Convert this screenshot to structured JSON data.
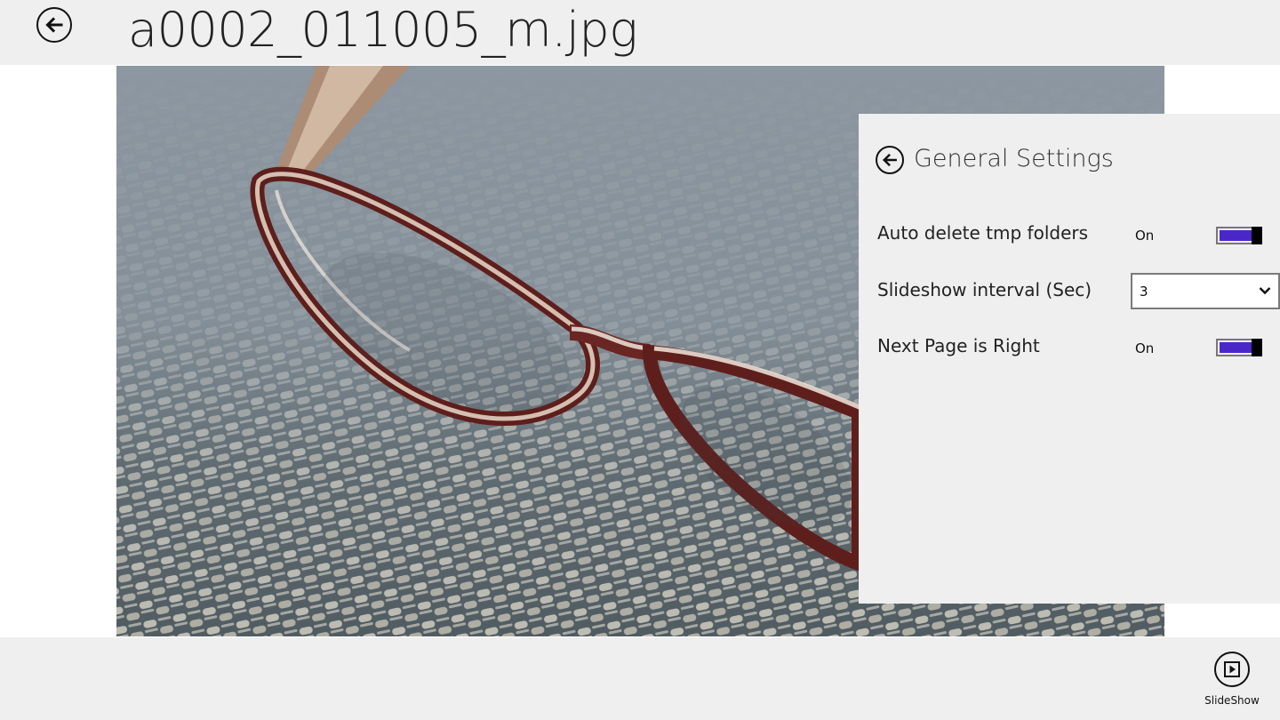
{
  "header": {
    "title": "a0002_011005_m.jpg",
    "back_icon": "back-arrow-icon"
  },
  "photo": {
    "subject": "eyeglasses-on-woven-mat"
  },
  "settings": {
    "title": "General Settings",
    "back_icon": "back-arrow-icon",
    "accent_color": "#4a27c8",
    "auto_delete": {
      "label": "Auto delete tmp folders",
      "state": "On",
      "on": true
    },
    "slideshow_interval": {
      "label": "Slideshow interval (Sec)",
      "value": "3"
    },
    "next_page": {
      "label": "Next Page is Right",
      "state": "On",
      "on": true
    }
  },
  "appbar": {
    "slideshow": {
      "label": "SlideShow",
      "icon": "play-icon"
    }
  }
}
